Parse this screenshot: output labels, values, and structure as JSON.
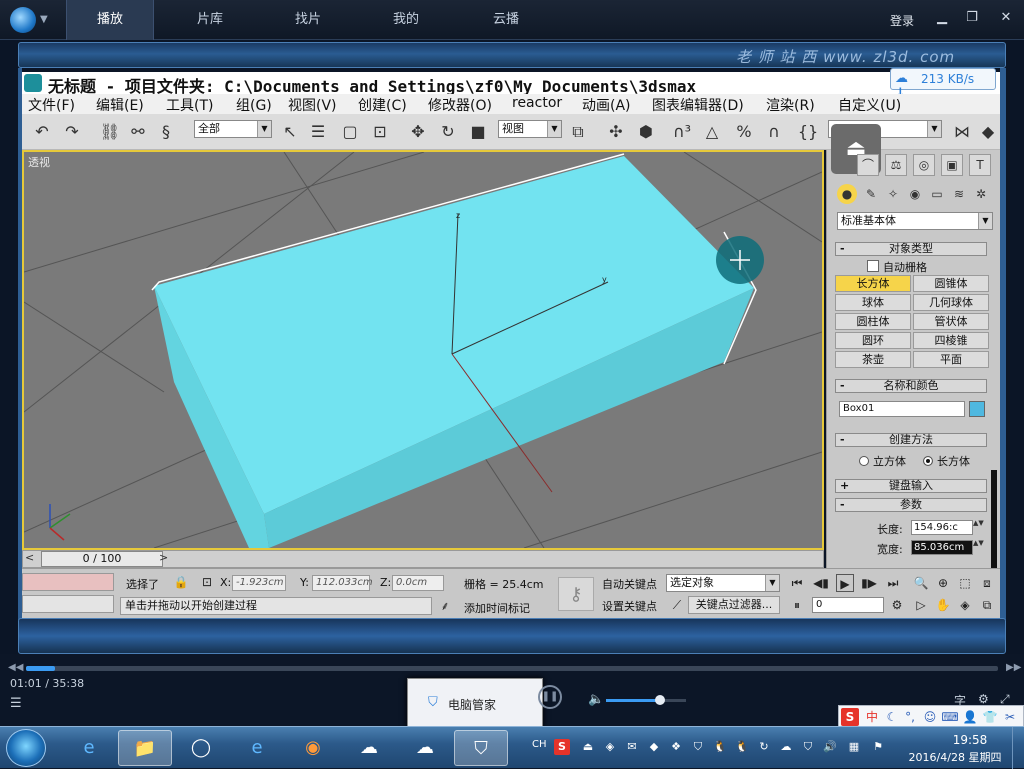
{
  "player": {
    "tabs": [
      "播放",
      "片库",
      "找片",
      "我的",
      "云播"
    ],
    "login": "登录",
    "watermark": "老 师 站 西 www. zl3d. com",
    "speed": "213 KB/s",
    "time": "01:01 / 35:38",
    "progress_fraction": 0.03,
    "volume_fraction": 0.68,
    "toast_text": "电脑管家",
    "subtitle_icon": "字"
  },
  "max": {
    "title": "无标题   - 项目文件夹: C:\\Documents and Settings\\zf0\\My Documents\\3dsmax",
    "menus": [
      "文件(F)",
      "编辑(E)",
      "工具(T)",
      "组(G)",
      "视图(V)",
      "创建(C)",
      "修改器(O)",
      "reactor",
      "动画(A)",
      "图表编辑器(D)",
      "渲染(R)",
      "自定义(U)"
    ],
    "selection_filter": "全部",
    "ref_coord": "视图",
    "viewport_label": "透视",
    "axis_labels": {
      "z": "z",
      "y": "y"
    },
    "panel": {
      "category_dropdown": "标准基本体",
      "rollout_object_type": "对象类型",
      "auto_grid": "自动栅格",
      "objects": [
        "长方体",
        "圆锥体",
        "球体",
        "几何球体",
        "圆柱体",
        "管状体",
        "圆环",
        "四棱锥",
        "茶壶",
        "平面"
      ],
      "active_object": "长方体",
      "rollout_name_color": "名称和颜色",
      "object_name": "Box01",
      "object_color": "#4fb8e0",
      "rollout_creation": "创建方法",
      "creation_cube": "立方体",
      "creation_box": "长方体",
      "rollout_keyboard": "键盘输入",
      "rollout_params": "参数",
      "length_label": "长度:",
      "length_value": "154.96:c",
      "width_label": "宽度:",
      "width_value": "85.036cm"
    },
    "timeslider": "0 / 100",
    "status": {
      "selected": "选择了",
      "prompt": "单击并拖动以开始创建过程",
      "x_label": "X:",
      "x_value": "-1.923cm",
      "y_label": "Y:",
      "y_value": "112.033cm",
      "z_label": "Z:",
      "z_value": "0.0cm",
      "grid": "栅格 = 25.4cm",
      "add_time_tag": "添加时间标记",
      "auto_key": "自动关键点",
      "set_key": "设置关键点",
      "key_mode": "选定对象",
      "key_filters": "关键点过滤器...",
      "frame": "0"
    }
  },
  "taskbar": {
    "ime_lang": "CH",
    "ime_mode": "中",
    "clock_time": "19:58",
    "clock_date": "2016/4/28 星期四"
  },
  "colors": {
    "box_cyan": "#72e3f0",
    "box_side": "#5ccbd8",
    "accent": "#3b9bf2"
  }
}
